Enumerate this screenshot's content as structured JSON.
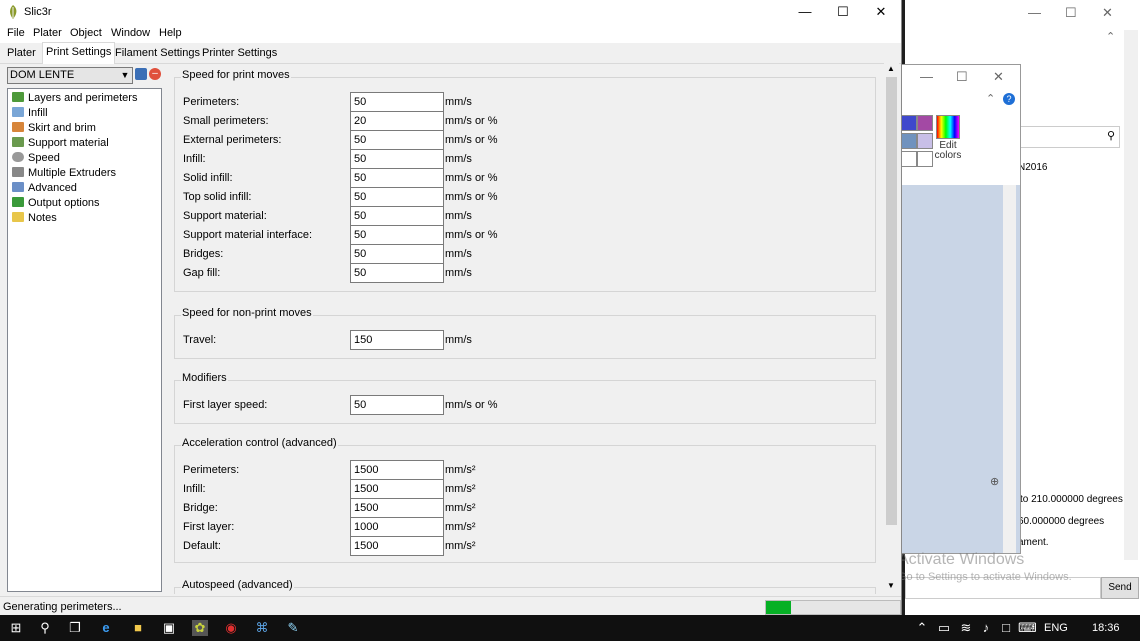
{
  "app": {
    "title": "Slic3r"
  },
  "menu": [
    "File",
    "Plater",
    "Object",
    "Window",
    "Help"
  ],
  "tabs": [
    "Plater",
    "Print Settings",
    "Filament Settings",
    "Printer Settings"
  ],
  "active_tab": "Print Settings",
  "preset": {
    "selected": "DOM LENTE"
  },
  "tree": [
    {
      "label": "Layers and perimeters",
      "color": "#4e9a3a"
    },
    {
      "label": "Infill",
      "color": "#7aa6d6"
    },
    {
      "label": "Skirt and brim",
      "color": "#d7853a"
    },
    {
      "label": "Support material",
      "color": "#6a9a4e"
    },
    {
      "label": "Speed",
      "color": "#999999"
    },
    {
      "label": "Multiple Extruders",
      "color": "#888888"
    },
    {
      "label": "Advanced",
      "color": "#6b8fc7"
    },
    {
      "label": "Output options",
      "color": "#3a9a3a"
    },
    {
      "label": "Notes",
      "color": "#e8c64a"
    }
  ],
  "groups": {
    "print_moves": {
      "title": "Speed for print moves",
      "rows": [
        {
          "label": "Perimeters:",
          "value": "50",
          "unit": "mm/s"
        },
        {
          "label": "Small perimeters:",
          "value": "20",
          "unit": "mm/s or %"
        },
        {
          "label": "External perimeters:",
          "value": "50",
          "unit": "mm/s or %"
        },
        {
          "label": "Infill:",
          "value": "50",
          "unit": "mm/s"
        },
        {
          "label": "Solid infill:",
          "value": "50",
          "unit": "mm/s or %"
        },
        {
          "label": "Top solid infill:",
          "value": "50",
          "unit": "mm/s or %"
        },
        {
          "label": "Support material:",
          "value": "50",
          "unit": "mm/s"
        },
        {
          "label": "Support material interface:",
          "value": "50",
          "unit": "mm/s or %"
        },
        {
          "label": "Bridges:",
          "value": "50",
          "unit": "mm/s"
        },
        {
          "label": "Gap fill:",
          "value": "50",
          "unit": "mm/s"
        }
      ]
    },
    "non_print": {
      "title": "Speed for non-print moves",
      "rows": [
        {
          "label": "Travel:",
          "value": "150",
          "unit": "mm/s"
        }
      ]
    },
    "modifiers": {
      "title": "Modifiers",
      "rows": [
        {
          "label": "First layer speed:",
          "value": "50",
          "unit": "mm/s or %"
        }
      ]
    },
    "acceleration": {
      "title": "Acceleration control (advanced)",
      "rows": [
        {
          "label": "Perimeters:",
          "value": "1500",
          "unit": "mm/s²"
        },
        {
          "label": "Infill:",
          "value": "1500",
          "unit": "mm/s²"
        },
        {
          "label": "Bridge:",
          "value": "1500",
          "unit": "mm/s²"
        },
        {
          "label": "First layer:",
          "value": "1000",
          "unit": "mm/s²"
        },
        {
          "label": "Default:",
          "value": "1500",
          "unit": "mm/s²"
        }
      ]
    },
    "autospeed": {
      "title": "Autospeed (advanced)"
    }
  },
  "status": {
    "text": "Generating perimeters...",
    "progress": 0.19
  },
  "background": {
    "edit_colors": "Edit colors",
    "text_2016": "N2016",
    "line1": "to 210.000000 degrees",
    "line2": "60.000000 degrees",
    "line3": "ament.",
    "send": "Send",
    "watermark_title": "Activate Windows",
    "watermark_sub": "Go to Settings to activate Windows."
  },
  "taskbar": {
    "lang": "ENG",
    "time": "18:36"
  }
}
